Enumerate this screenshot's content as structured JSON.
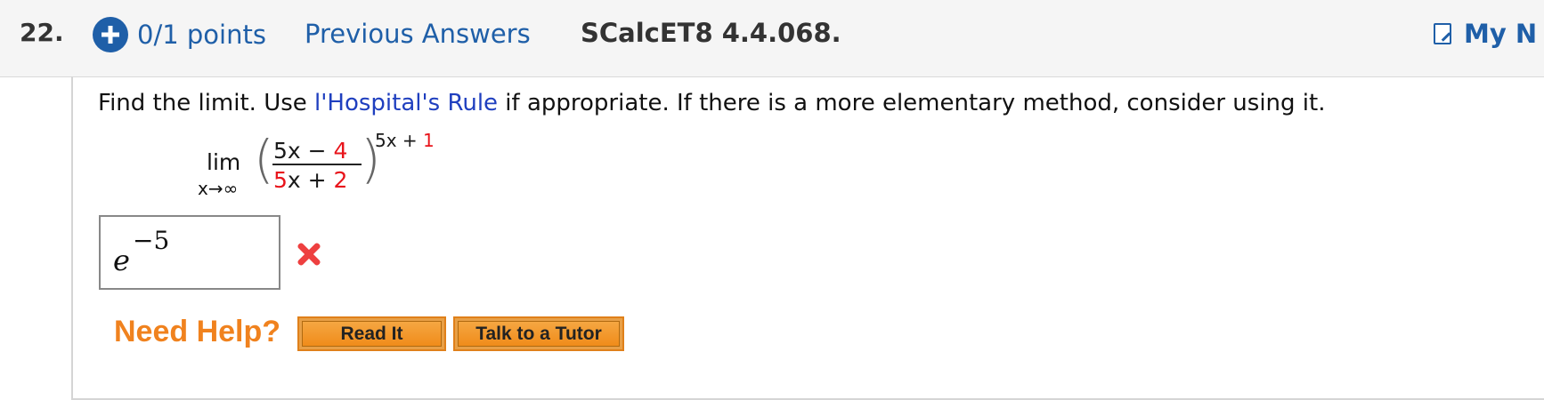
{
  "question": {
    "number": "22.",
    "points": "0/1 points",
    "previous_answers_label": "Previous Answers",
    "source_code": "SCalcET8 4.4.068.",
    "my_notes_label": "My N"
  },
  "prompt": {
    "before_link": "Find the limit. Use ",
    "link_text": "l'Hospital's Rule",
    "after_link": " if appropriate. If there is a more elementary method, consider using it."
  },
  "limit_expression": {
    "lim_label": "lim",
    "subscript": "x→∞",
    "numerator_var": "5x − ",
    "numerator_const": "4",
    "denominator_var": "5x + ",
    "denominator_const": "2",
    "exponent_var": "5x + ",
    "exponent_const": "1"
  },
  "answer": {
    "base": "e",
    "exponent": "−5",
    "status": "incorrect"
  },
  "help": {
    "label": "Need Help?",
    "read_it_label": "Read It",
    "tutor_label": "Talk to a Tutor"
  },
  "colors": {
    "link_blue": "#1f5fa8",
    "highlight_red": "#e8141b",
    "help_orange": "#f0821e"
  }
}
